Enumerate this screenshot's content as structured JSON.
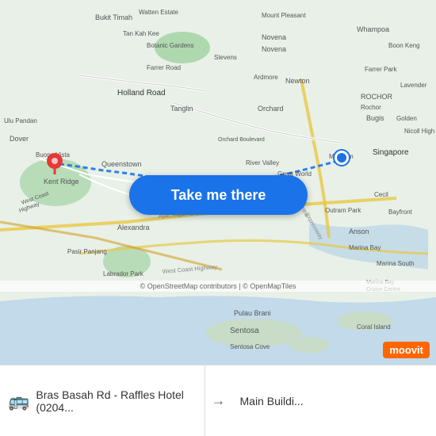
{
  "map": {
    "background_color": "#e8f4e8",
    "attribution": "© OpenStreetMap contributors | © OpenMapTiles"
  },
  "button": {
    "label": "Take me there"
  },
  "bottom_bar": {
    "origin": {
      "name": "Bras Basah Rd - Raffles Hotel (0204...",
      "short": "Bras Basah Rd - Raffles Hotel (0204..."
    },
    "destination": {
      "name": "Main Buildi...",
      "short": "Main Buildi..."
    },
    "arrow": "→"
  },
  "attribution": {
    "text": "© OpenStreetMap contributors | © OpenMapTiles"
  },
  "moovit": {
    "label": "moovit"
  },
  "map_labels": {
    "bukit_timah": "Bukit Timah",
    "watten_estate": "Watten Estate",
    "mount_pleasant": "Mount Pleasant",
    "tan_kah_kee": "Tan Kah Kee",
    "novena": "Novena",
    "botanic_gardens": "Botanic Gardens",
    "whampoa": "Whampoa",
    "boon_keng": "Boon Keng",
    "ulu_pandan": "Ulu Pandan",
    "farrer_road": "Farrer Road",
    "holland_road": "Holland Road",
    "ardmore": "Ardmore",
    "newton": "Newton",
    "farrer_park": "Farrer Park",
    "dover": "Dover",
    "tanglin": "Tanglin",
    "orchard": "Orchard",
    "lavender": "Lavender",
    "rochor": "ROCHOR",
    "bugis": "Bugis",
    "golden": "Golden",
    "buona_vista": "Buona Vista",
    "queenstown": "Queenstown",
    "orchard_boulevard": "Orchard Boulevard",
    "nicoll_high": "Nicoll High",
    "kent_ridge": "Kent Ridge",
    "river_valley": "River Valley",
    "great_world": "Great World",
    "museum": "Museum",
    "singapore": "Singapore",
    "west_coast_highway": "West Coast Highway",
    "alexandra": "Alexandra",
    "ayer_rajah": "Ayer Rajah Expressway",
    "central_expressway": "Central Expressway",
    "outram_park": "Outram Park",
    "cecill": "Cecil",
    "bayfront": "Bayfront",
    "pasir_panjang": "Pasir Panjang",
    "anson": "Anson",
    "marina_bay": "Marina Bay",
    "labrador_park": "Labrador Park",
    "marina_south": "Marina South",
    "west_coast_highway2": "West Coast Highway",
    "marina_bay_cruise": "Marina Bay Cruise Centre",
    "pulau_brani": "Pulau Brani",
    "sentosa": "Sentosa",
    "sentosa_cove": "Sentosa Cove",
    "coral_island": "Coral Island",
    "stevens": "Stevens"
  }
}
